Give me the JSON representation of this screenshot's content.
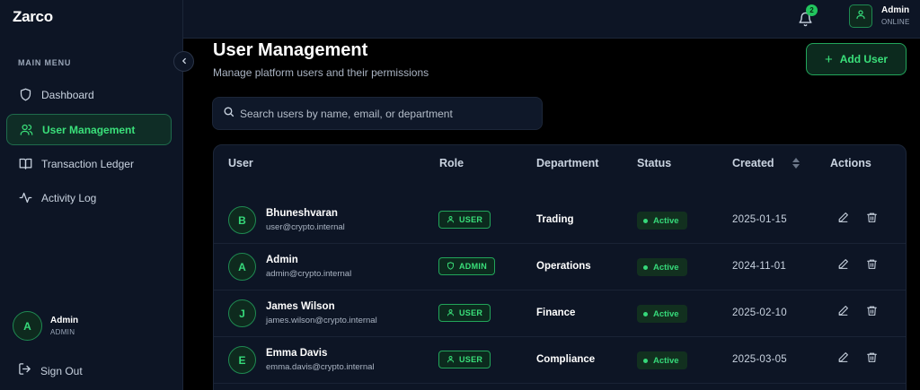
{
  "brand": "Zarco",
  "sidebar": {
    "menu_label": "MAIN MENU",
    "items": [
      {
        "label": "Dashboard",
        "icon": "shield-icon",
        "active": false
      },
      {
        "label": "User Management",
        "icon": "users-icon",
        "active": true
      },
      {
        "label": "Transaction Ledger",
        "icon": "book-icon",
        "active": false
      },
      {
        "label": "Activity Log",
        "icon": "activity-icon",
        "active": false
      }
    ],
    "user": {
      "initial": "A",
      "name": "Admin",
      "role": "ADMIN"
    },
    "sign_out": "Sign Out"
  },
  "topbar": {
    "notification_count": "2",
    "user": {
      "name": "Admin",
      "status": "ONLINE"
    }
  },
  "page": {
    "title": "User Management",
    "subtitle": "Manage platform users and their permissions",
    "add_button": "Add User",
    "search_placeholder": "Search users by name, email, or department"
  },
  "table": {
    "headers": [
      "User",
      "Role",
      "Department",
      "Status",
      "Created",
      "Actions"
    ],
    "rows": [
      {
        "initial": "B",
        "name": "Bhuneshvaran",
        "email": "user@crypto.internal",
        "role": "USER",
        "department": "Trading",
        "status": "Active",
        "created": "2025-01-15"
      },
      {
        "initial": "A",
        "name": "Admin",
        "email": "admin@crypto.internal",
        "role": "ADMIN",
        "department": "Operations",
        "status": "Active",
        "created": "2024-11-01"
      },
      {
        "initial": "J",
        "name": "James Wilson",
        "email": "james.wilson@crypto.internal",
        "role": "USER",
        "department": "Finance",
        "status": "Active",
        "created": "2025-02-10"
      },
      {
        "initial": "E",
        "name": "Emma Davis",
        "email": "emma.davis@crypto.internal",
        "role": "USER",
        "department": "Compliance",
        "status": "Active",
        "created": "2025-03-05"
      }
    ]
  },
  "colors": {
    "accent": "#3ae07a",
    "sidebar_bg": "#0d1525",
    "page_bg": "#000000"
  }
}
